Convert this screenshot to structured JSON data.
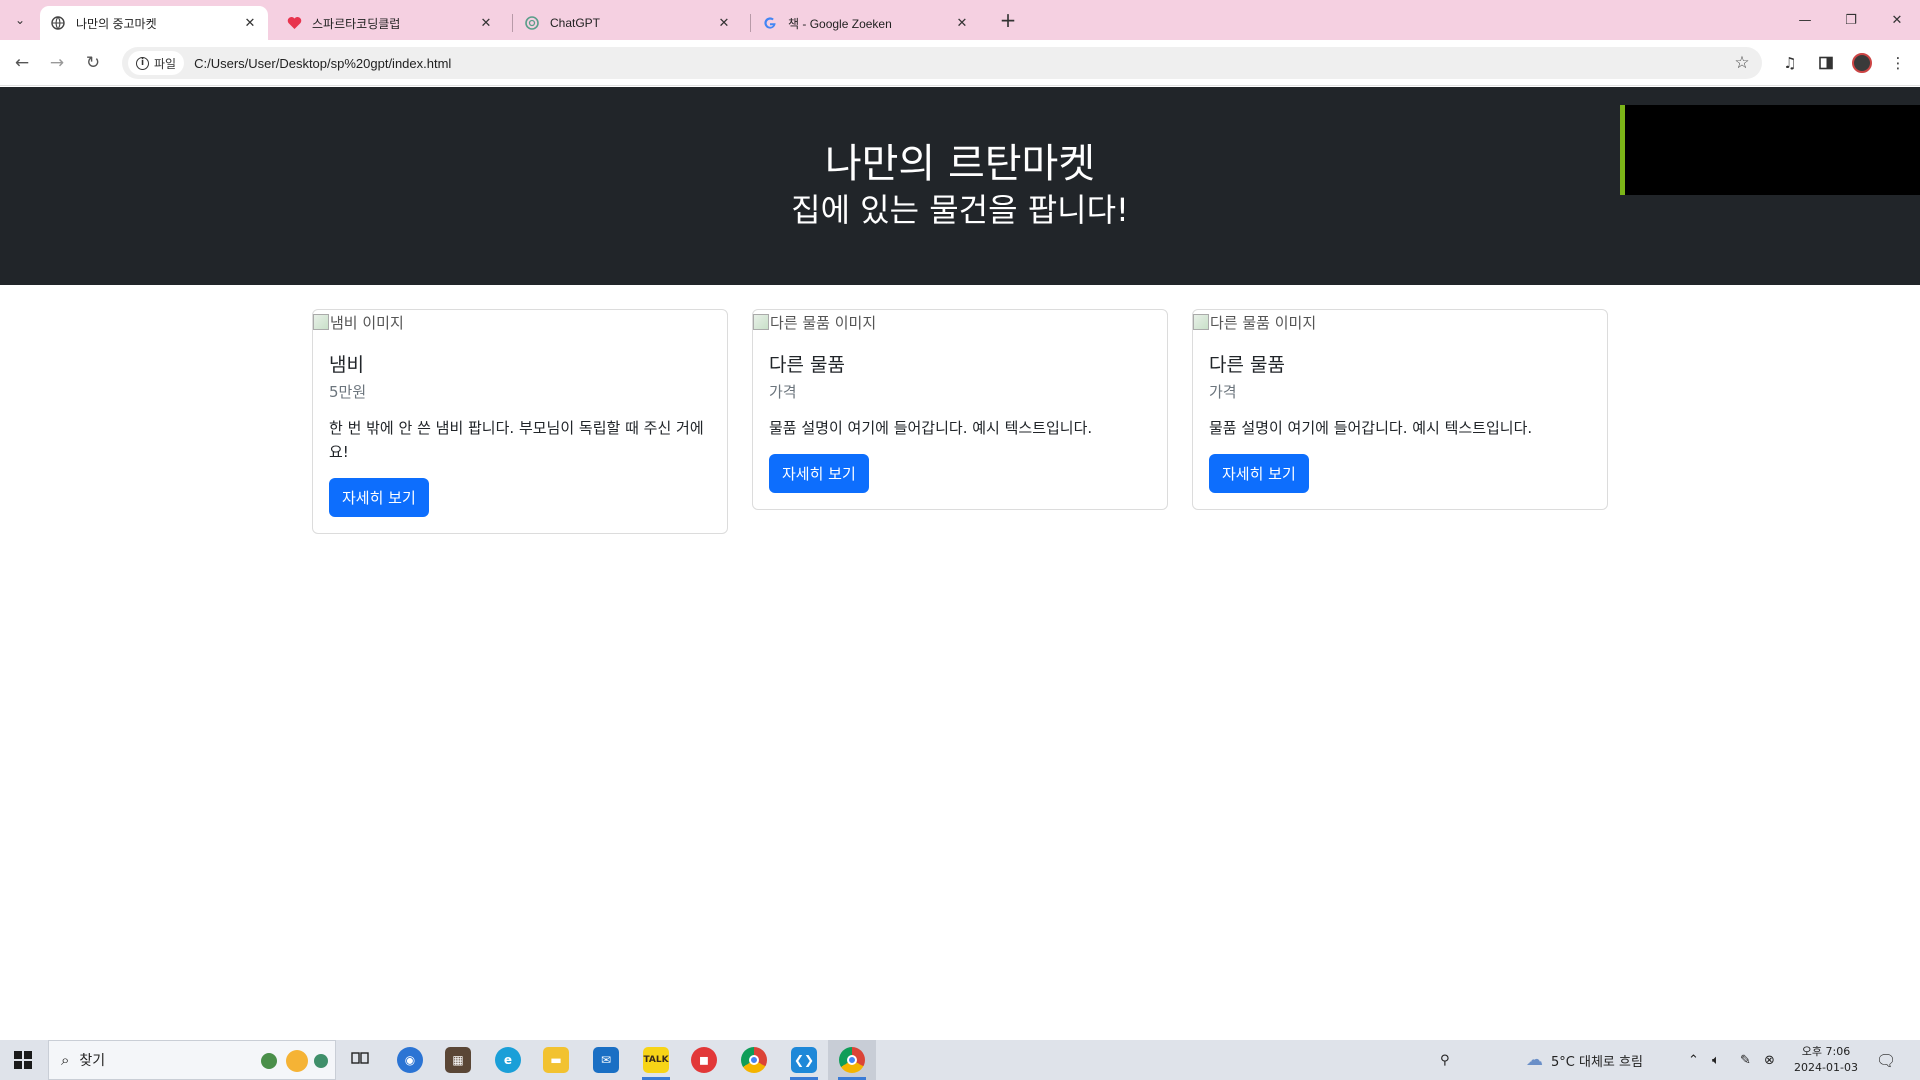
{
  "browser": {
    "tabs": [
      {
        "title": "나만의 중고마켓",
        "active": true,
        "favicon": "globe-icon"
      },
      {
        "title": "스파르타코딩클럽",
        "active": false,
        "favicon": "sparta-heart-icon"
      },
      {
        "title": "ChatGPT",
        "active": false,
        "favicon": "chatgpt-icon"
      },
      {
        "title": "책 - Google Zoeken",
        "active": false,
        "favicon": "google-icon"
      }
    ],
    "site_chip": "파일",
    "url": "C:/Users/User/Desktop/sp%20gpt/index.html"
  },
  "page": {
    "hero": {
      "title": "나만의 르탄마켓",
      "subtitle": "집에 있는 물건을 팝니다!"
    },
    "cards": [
      {
        "img_alt": "냄비 이미지",
        "title": "냄비",
        "price": "5만원",
        "text": "한 번 밖에 안 쓴 냄비 팝니다. 부모님이 독립할 때 주신 거에요!",
        "button": "자세히 보기"
      },
      {
        "img_alt": "다른 물품 이미지",
        "title": "다른 물품",
        "price": "가격",
        "text": "물품 설명이 여기에 들어갑니다. 예시 텍스트입니다.",
        "button": "자세히 보기"
      },
      {
        "img_alt": "다른 물품 이미지",
        "title": "다른 물품",
        "price": "가격",
        "text": "물품 설명이 여기에 들어갑니다. 예시 텍스트입니다.",
        "button": "자세히 보기"
      }
    ]
  },
  "taskbar": {
    "search_placeholder": "찾기",
    "weather": "5°C  대체로 흐림",
    "time": "오후 7:06",
    "date": "2024-01-03"
  },
  "colors": {
    "hero_bg": "#212529",
    "button_primary": "#0d6efd",
    "tabstrip_bg": "#f5d0e1",
    "hero_box_accent": "#7cb518"
  }
}
